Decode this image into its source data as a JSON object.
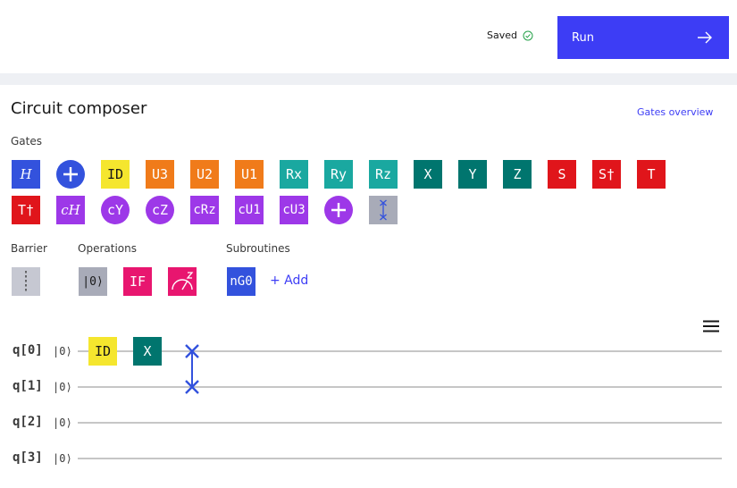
{
  "header": {
    "saved_label": "Saved",
    "run_label": "Run"
  },
  "composer": {
    "title": "Circuit composer",
    "overview_link": "Gates overview"
  },
  "sections": {
    "gates": "Gates",
    "barrier": "Barrier",
    "operations": "Operations",
    "subroutines": "Subroutines"
  },
  "gates_row1": [
    {
      "label": "H",
      "color": "#3352dd"
    },
    {
      "label": "",
      "color": "#3352dd",
      "icon": "plus-icon"
    },
    {
      "label": "ID",
      "color": "#f5e62e"
    },
    {
      "label": "U3",
      "color": "#f07b1a"
    },
    {
      "label": "U2",
      "color": "#f07b1a"
    },
    {
      "label": "U1",
      "color": "#f07b1a"
    },
    {
      "label": "Rx",
      "color": "#1aa8a0"
    },
    {
      "label": "Ry",
      "color": "#1aa8a0"
    },
    {
      "label": "Rz",
      "color": "#1aa8a0"
    },
    {
      "label": "X",
      "color": "#00756e"
    },
    {
      "label": "Y",
      "color": "#00756e"
    },
    {
      "label": "Z",
      "color": "#00756e"
    },
    {
      "label": "S",
      "color": "#e0151b"
    },
    {
      "label": "S†",
      "color": "#e0151b"
    },
    {
      "label": "T",
      "color": "#e0151b"
    }
  ],
  "gates_row2": [
    {
      "label": "T†",
      "color": "#e0151b"
    },
    {
      "label": "cH",
      "color": "#9d38e8"
    },
    {
      "label": "cY",
      "color": "#9d38e8"
    },
    {
      "label": "cZ",
      "color": "#9d38e8"
    },
    {
      "label": "cRz",
      "color": "#9d38e8"
    },
    {
      "label": "cU1",
      "color": "#9d38e8"
    },
    {
      "label": "cU3",
      "color": "#9d38e8"
    },
    {
      "label": "",
      "color": "#9d38e8",
      "icon": "plus-icon"
    },
    {
      "label": "",
      "color": "#a8abb8",
      "icon": "swap-icon"
    }
  ],
  "operations": {
    "reset": "|0⟩",
    "if": "IF",
    "measure_icon": "measure-icon"
  },
  "subroutines": {
    "ng0": "nG0",
    "add": "+ Add"
  },
  "qubits": [
    {
      "label": "q[0]",
      "init": "|0⟩"
    },
    {
      "label": "q[1]",
      "init": "|0⟩"
    },
    {
      "label": "q[2]",
      "init": "|0⟩"
    },
    {
      "label": "q[3]",
      "init": "|0⟩"
    }
  ],
  "circuit": {
    "q0_gate1": "ID",
    "q0_gate2": "X"
  },
  "colors": {
    "accent": "#3d3df5",
    "saved_check": "#24a148"
  }
}
